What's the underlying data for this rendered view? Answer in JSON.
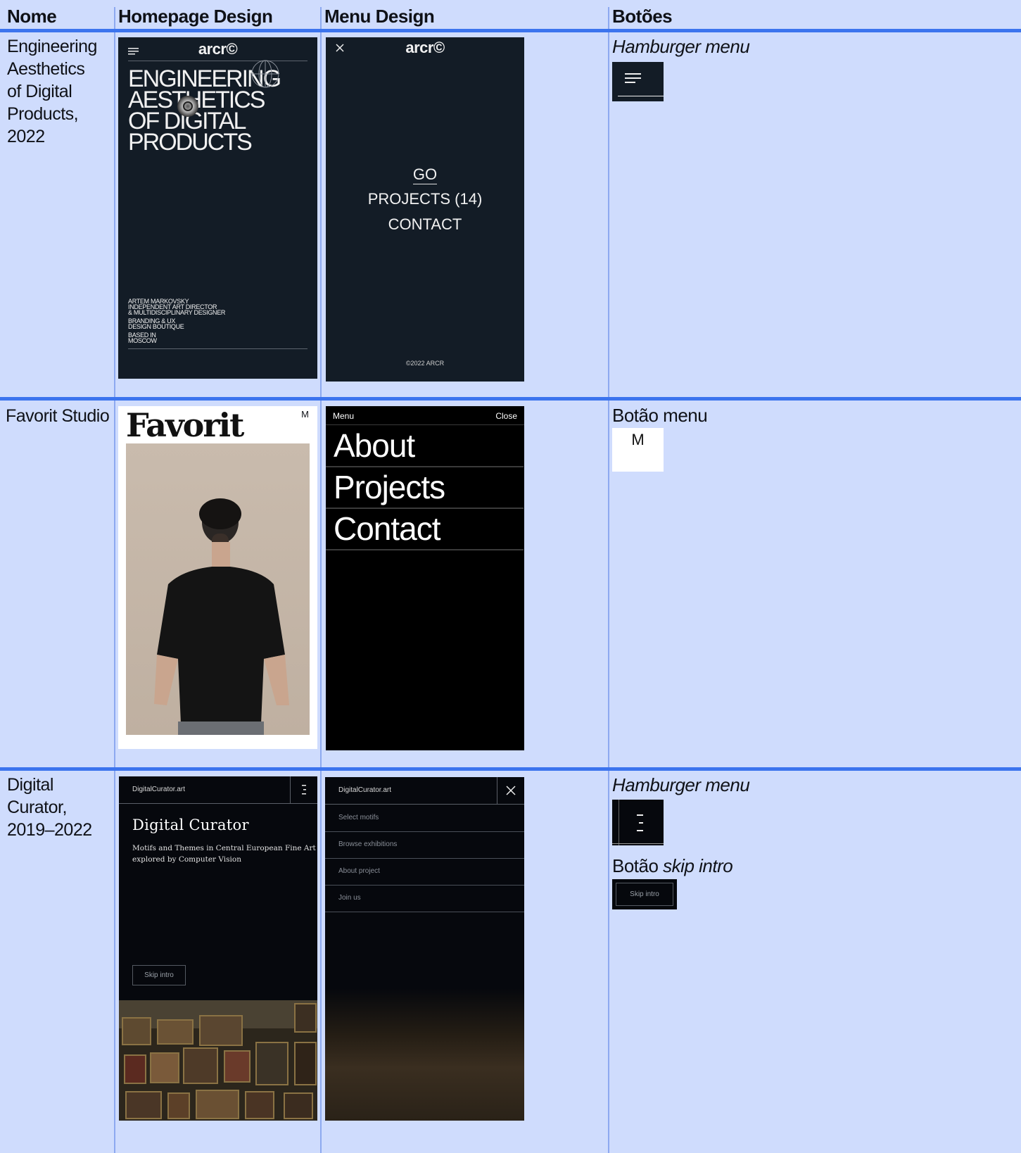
{
  "headers": {
    "nome": "Nome",
    "homepage": "Homepage Design",
    "menu": "Menu Design",
    "botoes": "Botões"
  },
  "rows": [
    {
      "name_lines": [
        "Engineering",
        "Aesthetics",
        "of Digital",
        "Products,",
        "2022"
      ],
      "homepage": {
        "logo": "arcr©",
        "title_lines": [
          "ENGINEERING",
          "AESTHETICS",
          "OF DIGITAL",
          "PRODUCTS"
        ],
        "info_lines": [
          "ARTEM MARKOVSKY",
          "INDEPENDENT ART DIRECTOR",
          "& MULTIDISCIPLINARY DESIGNER",
          "BRANDING & UX",
          "DESIGN BOUTIQUE",
          "BASED IN",
          "MOSCOW"
        ]
      },
      "menu": {
        "logo": "arcr©",
        "items": [
          "GO",
          "PROJECTS (14)",
          "CONTACT"
        ],
        "footer": "©2022 ARCR"
      },
      "buttons": {
        "label_italic": "Hamburger menu",
        "icon": "hamburger-icon"
      }
    },
    {
      "name": "Favorit Studio",
      "homepage": {
        "logo": "Favorit",
        "menu_letter": "M"
      },
      "menu": {
        "bar_left": "Menu",
        "bar_right": "Close",
        "items": [
          "About",
          "Projects",
          "Contact"
        ]
      },
      "buttons": {
        "label": "Botão menu",
        "button_letter": "M"
      }
    },
    {
      "name_lines": [
        "Digital",
        "Curator,",
        "2019–2022"
      ],
      "homepage": {
        "site": "DigitalCurator.art",
        "title": "Digital Curator",
        "subtitle_lines": [
          "Motifs and Themes in Central European Fine Art",
          "explored by Computer Vision"
        ],
        "skip": "Skip intro"
      },
      "menu": {
        "site": "DigitalCurator.art",
        "items": [
          "Select motifs",
          "Browse exhibitions",
          "About project",
          "Join us"
        ]
      },
      "buttons": {
        "label1_italic": "Hamburger menu",
        "label2_plain": "Botão ",
        "label2_italic": "skip intro",
        "skip": "Skip intro"
      }
    }
  ],
  "colors": {
    "background": "#cfdcfd",
    "rule": "#3c74ee",
    "column_line": "#8da9f0",
    "dark": "#131c26"
  }
}
